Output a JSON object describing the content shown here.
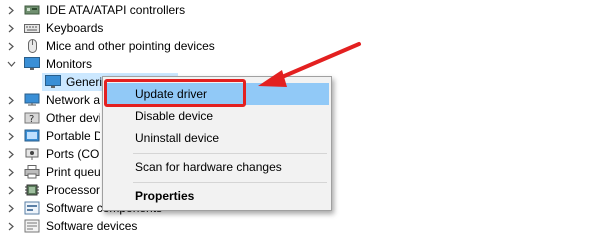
{
  "tree": {
    "items": [
      {
        "label": "IDE ATA/ATAPI controllers",
        "icon": "ide-controller-icon",
        "expanded": false
      },
      {
        "label": "Keyboards",
        "icon": "keyboard-icon",
        "expanded": false
      },
      {
        "label": "Mice and other pointing devices",
        "icon": "mouse-icon",
        "expanded": false
      },
      {
        "label": "Monitors",
        "icon": "monitor-icon",
        "expanded": true
      },
      {
        "label": "Generic PnP Monitor",
        "icon": "monitor-icon",
        "child": true,
        "selected": true
      },
      {
        "label": "Network a",
        "icon": "network-adapter-icon",
        "expanded": false
      },
      {
        "label": "Other devi",
        "icon": "other-devices-icon",
        "expanded": false
      },
      {
        "label": "Portable D",
        "icon": "portable-device-icon",
        "expanded": false
      },
      {
        "label": "Ports (COM",
        "icon": "ports-icon",
        "expanded": false
      },
      {
        "label": "Print queu",
        "icon": "printer-icon",
        "expanded": false
      },
      {
        "label": "Processors",
        "icon": "processor-icon",
        "expanded": false
      },
      {
        "label": "Software components",
        "icon": "software-component-icon",
        "expanded": false
      },
      {
        "label": "Software devices",
        "icon": "software-device-icon",
        "expanded": false
      }
    ]
  },
  "context_menu": {
    "update_driver": "Update driver",
    "disable_device": "Disable device",
    "uninstall_device": "Uninstall device",
    "scan_hardware": "Scan for hardware changes",
    "properties": "Properties"
  },
  "colors": {
    "highlight": "#91c9f7",
    "selected_row": "#cce8ff",
    "annotation_red": "#e32020"
  }
}
